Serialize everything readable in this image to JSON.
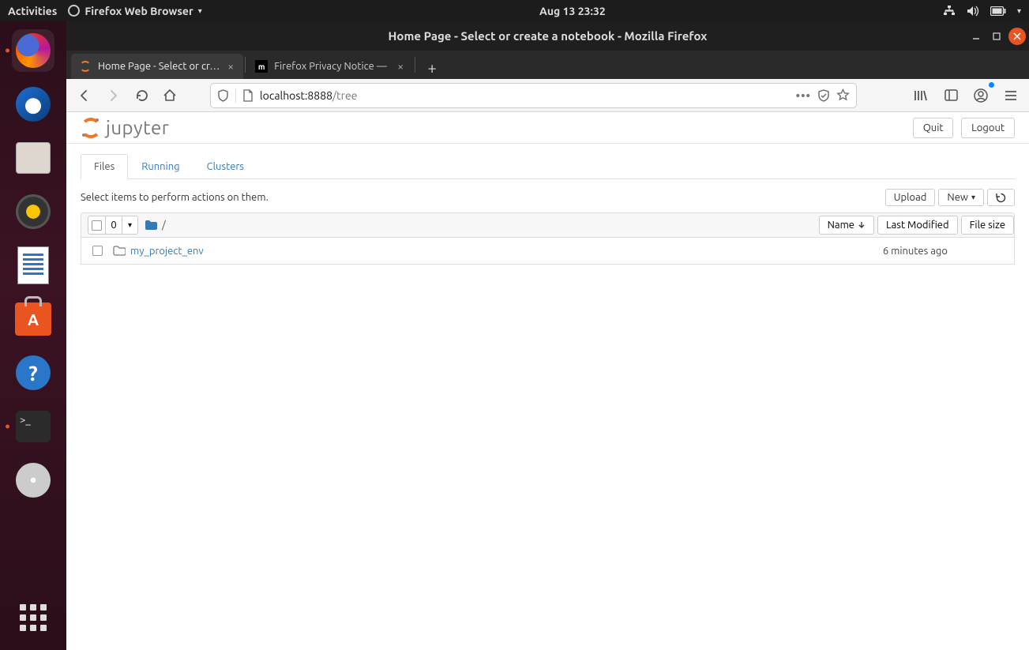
{
  "gnome": {
    "activities": "Activities",
    "appmenu": "Firefox Web Browser",
    "clock": "Aug 13  23:32"
  },
  "window_title": "Home Page - Select or create a notebook - Mozilla Firefox",
  "tabs": [
    {
      "title": "Home Page - Select or cr…",
      "active": true
    },
    {
      "title": "Firefox Privacy Notice —",
      "active": false
    }
  ],
  "url": {
    "host": "localhost",
    "port": ":8888",
    "path": "/tree"
  },
  "jupyter": {
    "logo_text": "jupyter",
    "quit": "Quit",
    "logout": "Logout",
    "tabs": {
      "files": "Files",
      "running": "Running",
      "clusters": "Clusters"
    },
    "hint": "Select items to perform actions on them.",
    "upload": "Upload",
    "new": "New",
    "selcount": "0",
    "breadcrumb_sep": "/",
    "col_name": "Name",
    "col_modified": "Last Modified",
    "col_size": "File size",
    "rows": [
      {
        "name": "my_project_env",
        "modified": "6 minutes ago",
        "size": ""
      }
    ]
  }
}
